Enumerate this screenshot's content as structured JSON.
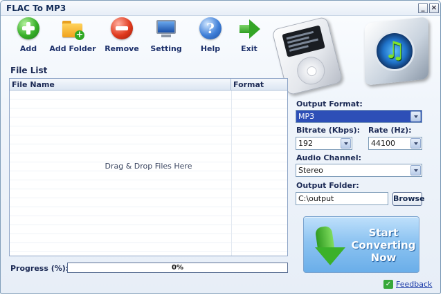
{
  "window": {
    "title": "FLAC To MP3",
    "minimize_glyph": "_",
    "close_glyph": "×"
  },
  "toolbar": {
    "items": [
      {
        "label": "Add",
        "icon": "add-icon"
      },
      {
        "label": "Add Folder",
        "icon": "add-folder-icon"
      },
      {
        "label": "Remove",
        "icon": "remove-icon"
      },
      {
        "label": "Setting",
        "icon": "monitor-icon"
      },
      {
        "label": "Help",
        "icon": "help-icon"
      },
      {
        "label": "Exit",
        "icon": "exit-arrow-icon"
      }
    ]
  },
  "file_list": {
    "label": "File List",
    "columns": [
      "File Name",
      "Format"
    ],
    "drop_hint": "Drag & Drop Files Here"
  },
  "settings": {
    "output_format_label": "Output Format:",
    "output_format_value": "MP3",
    "bitrate_label": "Bitrate (Kbps):",
    "bitrate_value": "192",
    "rate_label": "Rate (Hz):",
    "rate_value": "44100",
    "audio_channel_label": "Audio Channel:",
    "audio_channel_value": "Stereo",
    "output_folder_label": "Output Folder:",
    "output_folder_value": "C:\\output",
    "browse_label": "Browse"
  },
  "start": {
    "label": "Start Converting Now",
    "icon": "start-arrow-icon"
  },
  "progress": {
    "label": "Progress (%):",
    "value_text": "0%",
    "fraction": 0
  },
  "feedback": {
    "label": "Feedback",
    "icon_glyph": "✓"
  },
  "colors": {
    "selection": "#2d4fb7",
    "accent_green": "#34a526",
    "panel_blue": "#8cc3f1"
  }
}
